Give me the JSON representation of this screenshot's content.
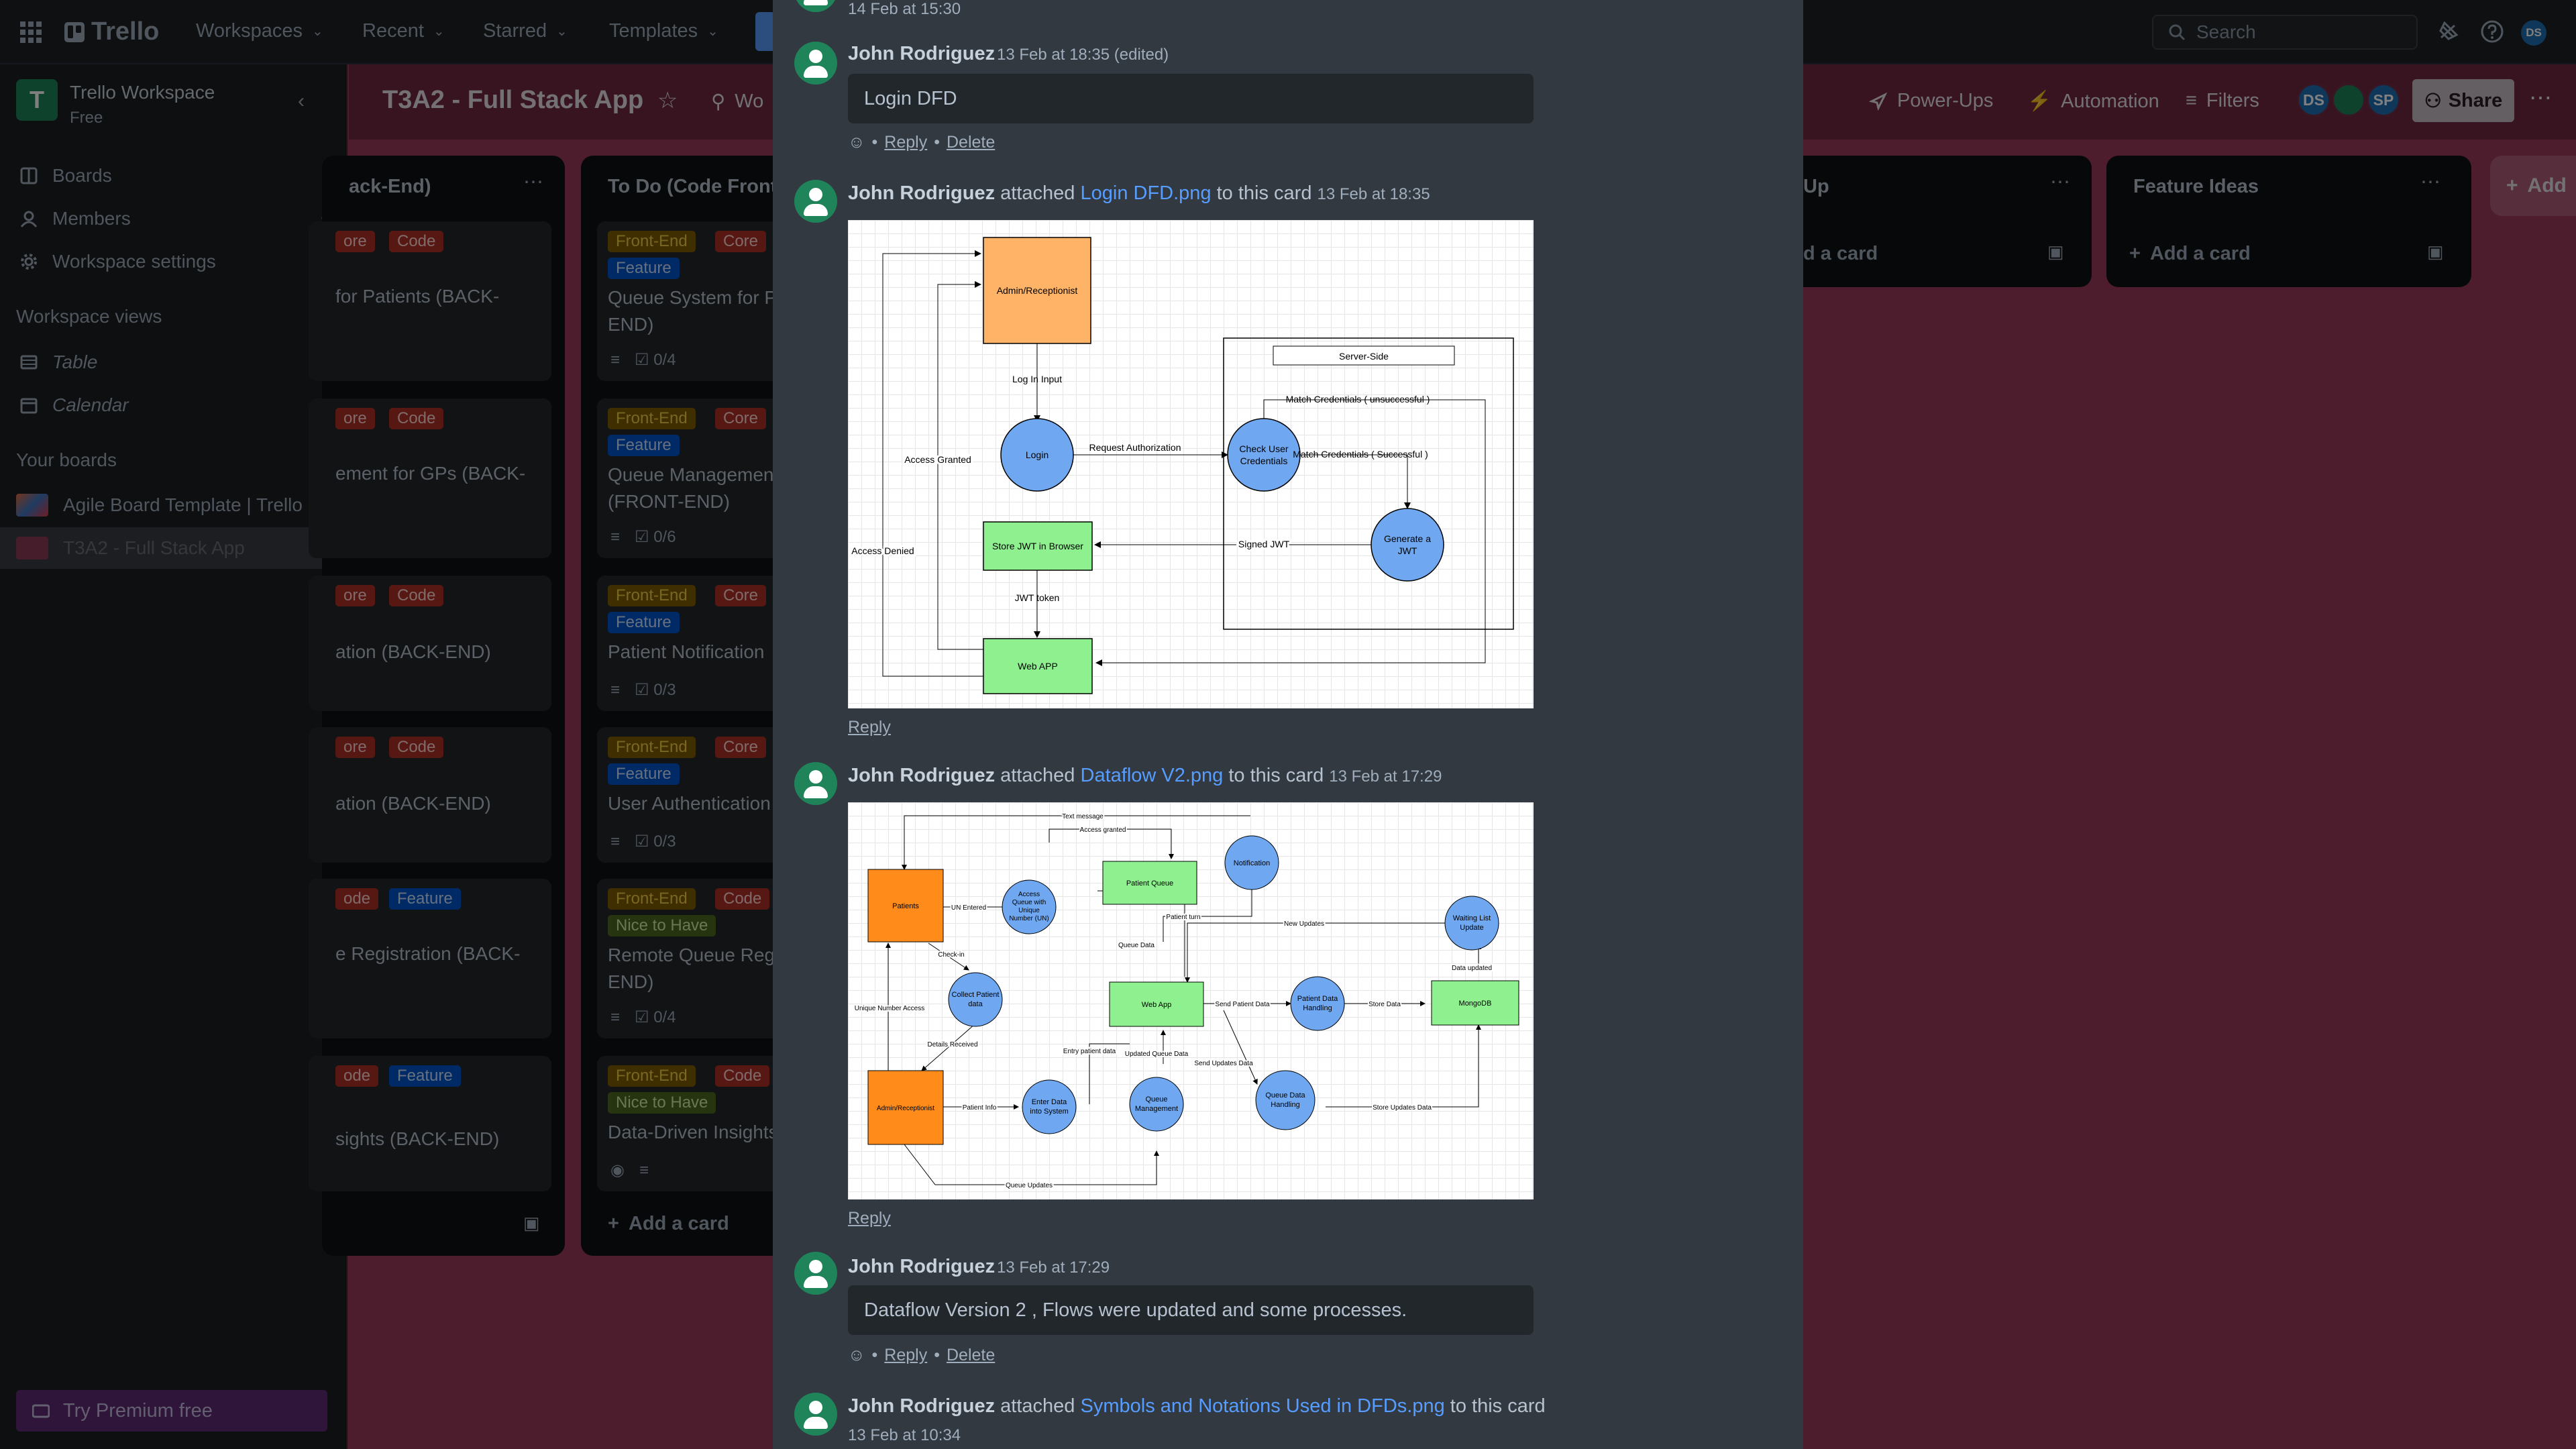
{
  "topbar": {
    "app_name": "Trello",
    "nav": [
      "Workspaces",
      "Recent",
      "Starred",
      "Templates"
    ],
    "search_placeholder": "Search",
    "user_initials": "DS"
  },
  "sidebar": {
    "workspace_logo": "T",
    "workspace_name": "Trello Workspace",
    "workspace_plan": "Free",
    "items": [
      "Boards",
      "Members",
      "Workspace settings"
    ],
    "views_heading": "Workspace views",
    "views": [
      "Table",
      "Calendar"
    ],
    "your_boards_heading": "Your boards",
    "boards": [
      "Agile Board Template | Trello",
      "T3A2 - Full Stack App"
    ],
    "premium": "Try Premium free"
  },
  "board": {
    "title": "T3A2 - Full Stack App",
    "visibility_partial": "Wo",
    "power_ups": "Power-Ups",
    "automation": "Automation",
    "filters": "Filters",
    "members": [
      "DS",
      "SP"
    ],
    "share": "Share"
  },
  "lists": {
    "backend": {
      "title": "ack-End)",
      "cards": [
        {
          "labels": [
            "ore",
            "Code"
          ],
          "title": "for Patients (BACK-"
        },
        {
          "labels": [
            "ore",
            "Code"
          ],
          "title": "ement for GPs (BACK-"
        },
        {
          "labels": [
            "ore",
            "Code"
          ],
          "title": "ation (BACK-END)"
        },
        {
          "labels": [
            "ore",
            "Code"
          ],
          "title": "ation (BACK-END)"
        },
        {
          "labels": [
            "ode",
            "Feature"
          ],
          "title": "e Registration (BACK-"
        },
        {
          "labels": [
            "ode",
            "Feature"
          ],
          "title": "sights (BACK-END)"
        }
      ]
    },
    "frontend": {
      "title": "To Do (Code Front-",
      "add": "Add a card",
      "cards": [
        {
          "labels": [
            "Front-End",
            "Core",
            "Feature"
          ],
          "lines": [
            "Queue System for P",
            "END)"
          ],
          "checklist": "0/4"
        },
        {
          "labels": [
            "Front-End",
            "Core",
            "Feature"
          ],
          "lines": [
            "Queue Managemen",
            "(FRONT-END)"
          ],
          "checklist": "0/6"
        },
        {
          "labels": [
            "Front-End",
            "Core",
            "Feature"
          ],
          "lines": [
            "Patient Notification"
          ],
          "checklist": "0/3"
        },
        {
          "labels": [
            "Front-End",
            "Core",
            "Feature"
          ],
          "lines": [
            "User Authentication"
          ],
          "checklist": "0/3"
        },
        {
          "labels": [
            "Front-End",
            "Code",
            "Nice to Have"
          ],
          "lines": [
            "Remote Queue Regi",
            "END)"
          ],
          "checklist": "0/4"
        },
        {
          "labels": [
            "Front-End",
            "Code",
            "Nice to Have"
          ],
          "lines": [
            "Data-Driven Insights"
          ],
          "checklist": ""
        }
      ]
    },
    "followup": {
      "title": "Up",
      "add": "d a card"
    },
    "ideas": {
      "title": "Feature Ideas",
      "add": "Add a card"
    },
    "add_list": "Add"
  },
  "activity": {
    "top_timestamp": "14 Feb at 15:30",
    "comment1": {
      "author": "John Rodriguez",
      "meta": "13 Feb at 18:35 (edited)",
      "text": "Login DFD",
      "reply": "Reply",
      "delete": "Delete"
    },
    "attach1": {
      "author": "John Rodriguez",
      "verb": "attached",
      "file": "Login DFD.png",
      "suffix": "to this card",
      "meta": "13 Feb at 18:35",
      "reply": "Reply"
    },
    "attach2": {
      "author": "John Rodriguez",
      "verb": "attached",
      "file": "Dataflow V2.png",
      "suffix": "to this card",
      "meta": "13 Feb at 17:29",
      "reply": "Reply"
    },
    "comment2": {
      "author": "John Rodriguez",
      "meta": "13 Feb at 17:29",
      "text": "Dataflow Version 2 , Flows were updated and some processes.",
      "reply": "Reply",
      "delete": "Delete"
    },
    "attach3": {
      "author": "John Rodriguez",
      "verb": "attached",
      "file": "Symbols and Notations Used in DFDs.png",
      "suffix": "to this card",
      "meta": "13 Feb at 10:34"
    }
  },
  "login_dfd": {
    "admin": "Admin/Receptionist",
    "login_input": "Log In Input",
    "login": "Login",
    "access_granted": "Access Granted",
    "access_denied": "Access Denied",
    "request_auth": "Request Authorization",
    "server_side": "Server-Side",
    "match_unsuccess": "Match Credentials ( unsuccessful )",
    "check_creds": [
      "Check User",
      "Credentials"
    ],
    "match_success": "Match Credentials ( Successful )",
    "generate": [
      "Generate a",
      "JWT"
    ],
    "signed_jwt": "Signed JWT",
    "store_jwt": "Store JWT in Browser",
    "jwt_token": "JWT token",
    "web_app": "Web APP"
  },
  "dataflow_v2": {
    "text_message": "Text message",
    "access_granted": "Access granted",
    "patients": "Patients",
    "un_entered": "UN Entered",
    "access_queue": [
      "Access",
      "Queue with",
      "Unique",
      "Number (UN)"
    ],
    "patient_queue": "Patient Queue",
    "notification": "Notification",
    "patient_turn": "Patient turn",
    "new_updates": "New Updates",
    "waiting_list": [
      "Waiting List",
      "Update"
    ],
    "data_updated": "Data updated",
    "check_in": "Check-in",
    "collect": [
      "Collect Patient",
      "data"
    ],
    "queue_data": "Queue Data",
    "web_app": "Web App",
    "send_patient_data": "Send Patient Data",
    "patient_handling": [
      "Patient Data",
      "Handling"
    ],
    "store_data": "Store Data",
    "mongodb": "MongoDB",
    "unique_access": "Unique Number Access",
    "details_received": "Details Received",
    "entry_patient_data": "Entry patient data",
    "updated_queue_data": "Updated Queue Data",
    "send_updates": "Send Updates Data",
    "admin": "Admin/Receptionist",
    "patient_info": "Patient Info",
    "enter_data": [
      "Enter Data",
      "into System"
    ],
    "queue_mgmt": [
      "Queue",
      "Management"
    ],
    "queue_handling": [
      "Queue Data",
      "Handling"
    ],
    "store_updates": "Store Updates Data",
    "queue_updates": "Queue Updates"
  }
}
